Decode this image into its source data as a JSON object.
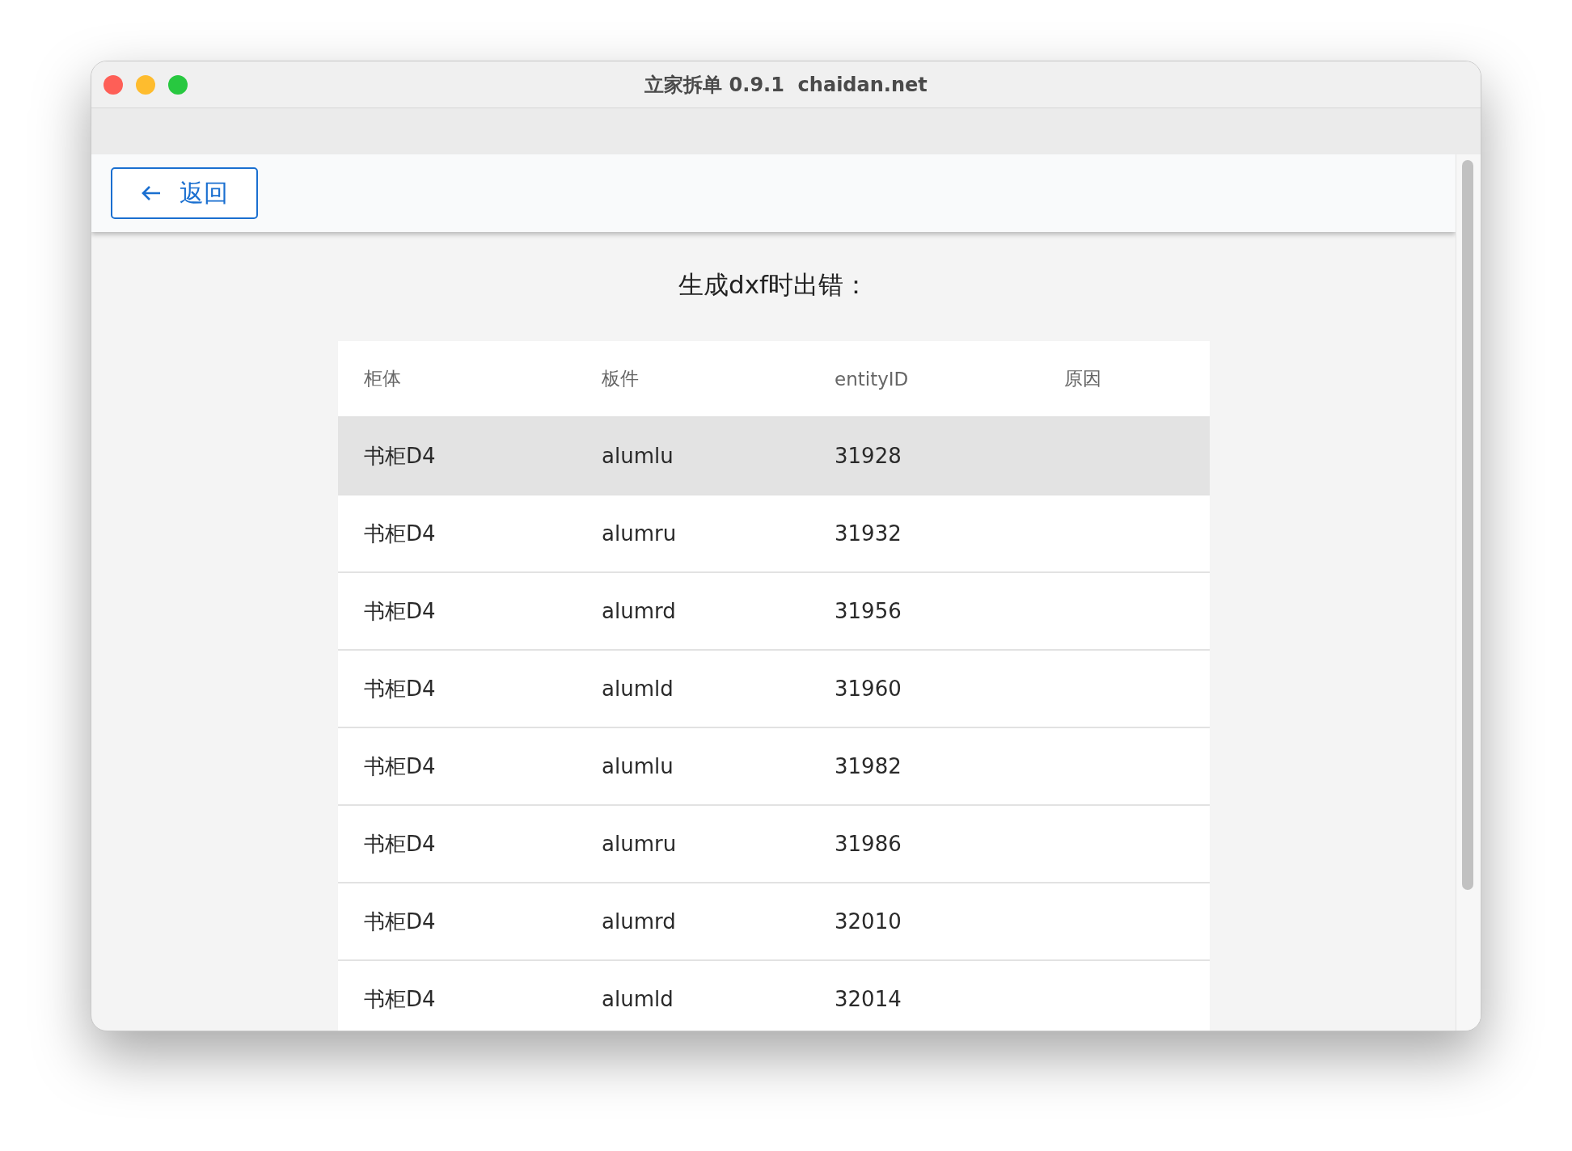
{
  "window": {
    "title": "立家拆单 0.9.1  chaidan.net"
  },
  "toolbar": {
    "back_button": {
      "label": "返回"
    }
  },
  "heading": "生成dxf时出错：",
  "table": {
    "columns": [
      "柜体",
      "板件",
      "entityID",
      "原因"
    ],
    "rows": [
      {
        "cells": [
          "书柜D4",
          "alumlu",
          "31928",
          ""
        ],
        "selected": true
      },
      {
        "cells": [
          "书柜D4",
          "alumru",
          "31932",
          ""
        ],
        "selected": false
      },
      {
        "cells": [
          "书柜D4",
          "alumrd",
          "31956",
          ""
        ],
        "selected": false
      },
      {
        "cells": [
          "书柜D4",
          "alumld",
          "31960",
          ""
        ],
        "selected": false
      },
      {
        "cells": [
          "书柜D4",
          "alumlu",
          "31982",
          ""
        ],
        "selected": false
      },
      {
        "cells": [
          "书柜D4",
          "alumru",
          "31986",
          ""
        ],
        "selected": false
      },
      {
        "cells": [
          "书柜D4",
          "alumrd",
          "32010",
          ""
        ],
        "selected": false
      },
      {
        "cells": [
          "书柜D4",
          "alumld",
          "32014",
          ""
        ],
        "selected": false
      }
    ]
  }
}
